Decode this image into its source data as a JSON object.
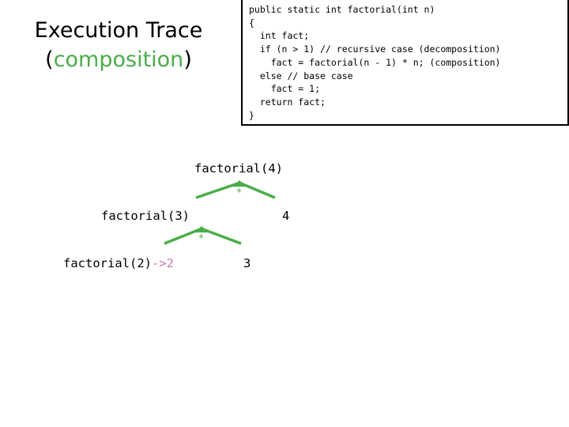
{
  "title": {
    "line1": "Execution Trace",
    "open_paren": "(",
    "accent_word": "composition",
    "close_paren": ")",
    "accent_color": "#4aad4a"
  },
  "code_box": {
    "language": "java",
    "border_color": "#000000",
    "listing": "public static int factorial(int n)\n{\n  int fact;\n  if (n > 1) // recursive case (decomposition)\n    fact = factorial(n - 1) * n; (composition)\n  else // base case\n    fact = 1;\n  return fact;\n}"
  },
  "trace": {
    "arrow_color": "#4aad4a",
    "return_color": "#cc77aa",
    "operator_symbol": "*",
    "levels": [
      {
        "call_label": "factorial(4)",
        "multiplier_label": "4",
        "operator": "*"
      },
      {
        "call_label": "factorial(3)",
        "multiplier_label": "3",
        "operator": "*"
      },
      {
        "call_label": "factorial(2)",
        "return_label": "->2"
      }
    ]
  }
}
